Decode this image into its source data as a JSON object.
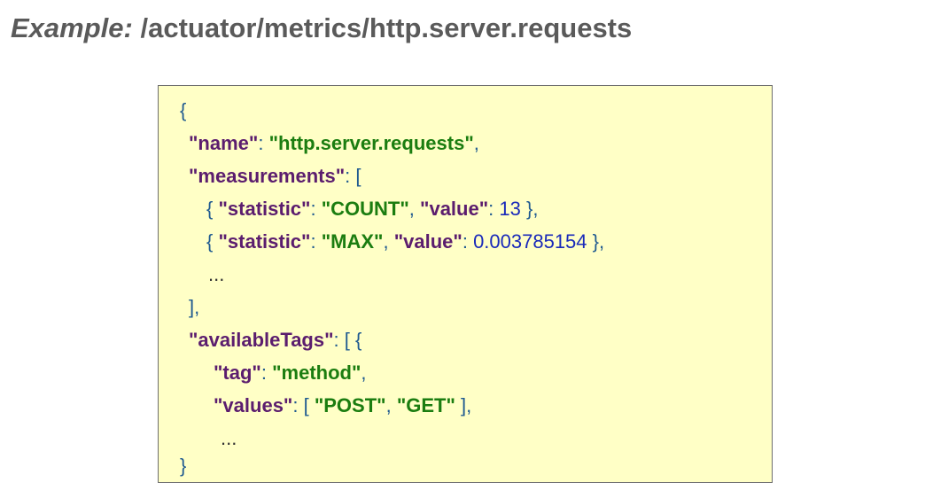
{
  "slide": {
    "title_label": "Example:",
    "title_path": "/actuator/metrics/http.server.requests"
  },
  "code": {
    "open_brace": "{",
    "close_brace": "}",
    "name_key": "\"name\"",
    "name_value": "\"http.server.requests\"",
    "measurements_key": "\"measurements\"",
    "measurements": [
      {
        "statistic_key": "\"statistic\"",
        "statistic_value": "\"COUNT\"",
        "value_key": "\"value\"",
        "value": "13"
      },
      {
        "statistic_key": "\"statistic\"",
        "statistic_value": "\"MAX\"",
        "value_key": "\"value\"",
        "value": "0.003785154"
      }
    ],
    "measurements_more": "...",
    "available_tags_key": "\"availableTags\"",
    "tag_key": "\"tag\"",
    "tag_value": "\"method\"",
    "values_key": "\"values\"",
    "values": [
      "\"POST\"",
      "\"GET\""
    ],
    "tags_more": "..."
  },
  "colors": {
    "title": "#5a5a5a",
    "box_background": "#ffffc6",
    "box_border": "#6e6e6e",
    "json_key": "#5b1d6e",
    "json_string": "#1b7d10",
    "json_number": "#1a2aba",
    "json_punctuation": "#1f5a90"
  }
}
